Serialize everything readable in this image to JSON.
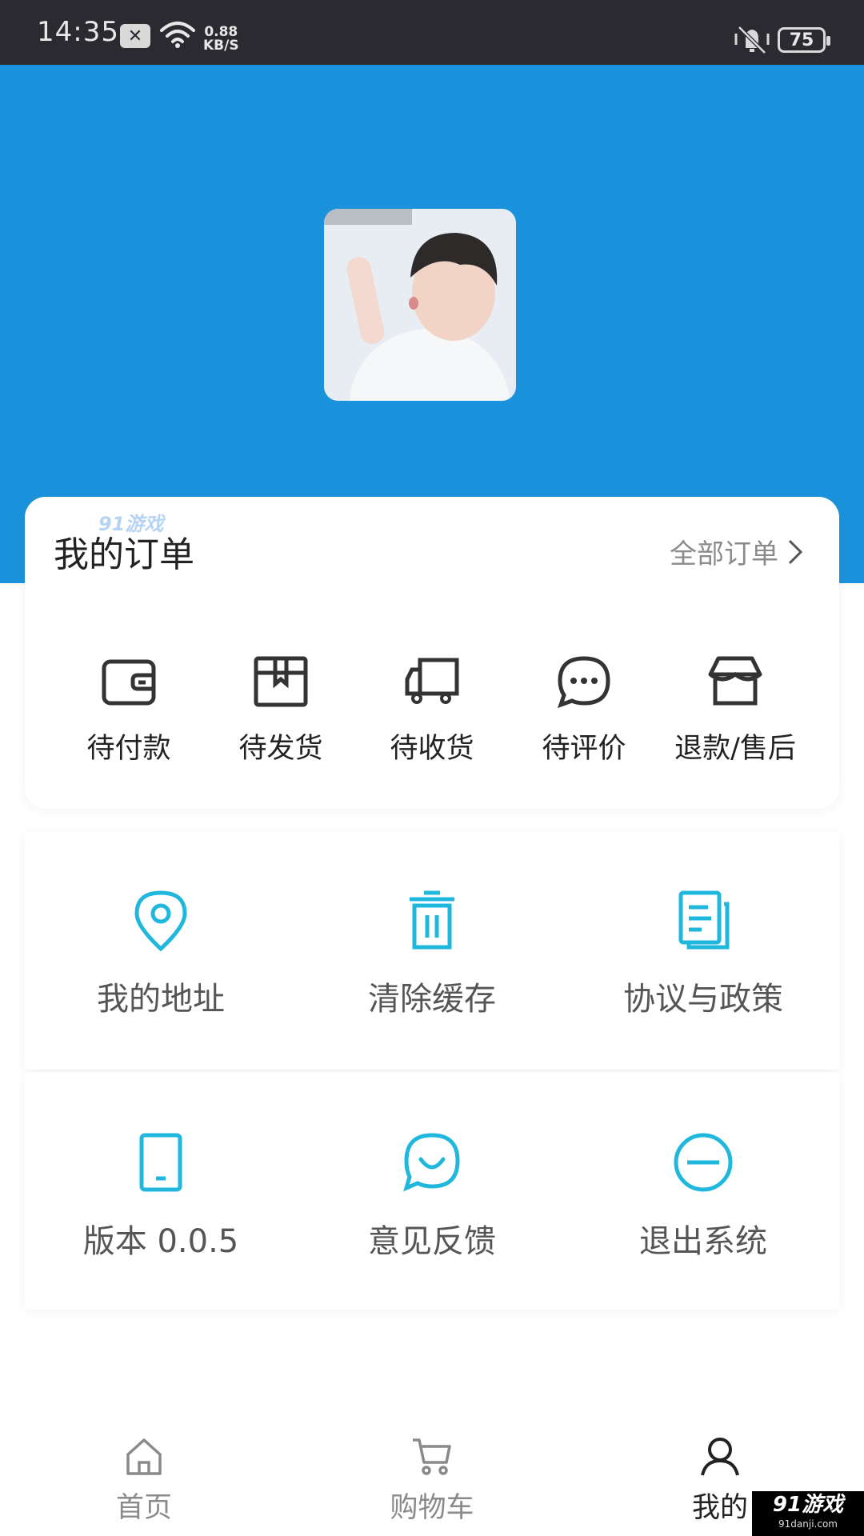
{
  "status_bar": {
    "time": "14:35",
    "network_speed": "0.88",
    "network_unit": "KB/S",
    "battery": "75"
  },
  "colors": {
    "header_blue": "#1b93dc",
    "icon_cyan": "#20b7dd",
    "text_dark": "#222222",
    "text_gray": "#8b8b8b"
  },
  "profile": {
    "avatar_icon": "user-photo"
  },
  "orders": {
    "title": "我的订单",
    "all_label": "全部订单",
    "watermark": "91游戏",
    "items": [
      {
        "label": "待付款",
        "icon": "wallet-icon"
      },
      {
        "label": "待发货",
        "icon": "package-icon"
      },
      {
        "label": "待收货",
        "icon": "truck-icon"
      },
      {
        "label": "待评价",
        "icon": "chat-bubble-icon"
      },
      {
        "label": "退款/售后",
        "icon": "store-icon"
      }
    ]
  },
  "services": {
    "row1": [
      {
        "label": "我的地址",
        "icon": "location-pin-icon"
      },
      {
        "label": "清除缓存",
        "icon": "trash-icon"
      },
      {
        "label": "协议与政策",
        "icon": "document-icon"
      }
    ],
    "row2": [
      {
        "label": "版本 0.0.5",
        "icon": "tablet-icon"
      },
      {
        "label": "意见反馈",
        "icon": "feedback-icon"
      },
      {
        "label": "退出系统",
        "icon": "minus-circle-icon"
      }
    ]
  },
  "tab_bar": {
    "items": [
      {
        "label": "首页",
        "icon": "home-icon"
      },
      {
        "label": "购物车",
        "icon": "cart-icon"
      },
      {
        "label": "我的",
        "icon": "user-icon",
        "active": true
      }
    ]
  },
  "brand_watermark": {
    "title": "91游戏",
    "domain": "91danji.com"
  }
}
